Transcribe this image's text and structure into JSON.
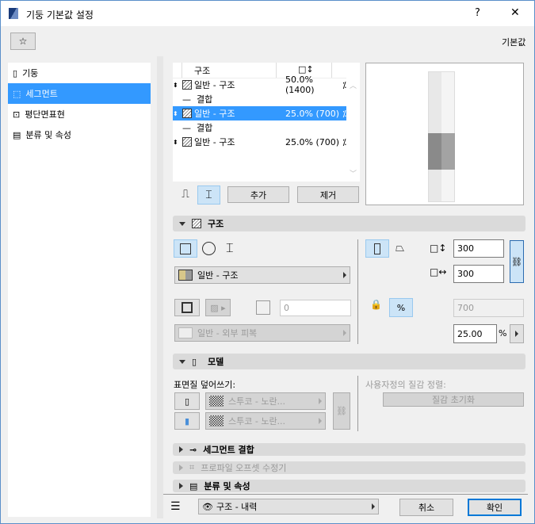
{
  "window": {
    "title": "기둥 기본값 설정",
    "help": "?",
    "close": "✕",
    "defaults_label": "기본값"
  },
  "sidebar": {
    "items": [
      {
        "label": "기둥",
        "icon": "column-icon"
      },
      {
        "label": "세그먼트",
        "icon": "segment-icon"
      },
      {
        "label": "평단면표현",
        "icon": "floor-plan-icon"
      },
      {
        "label": "분류 및 속성",
        "icon": "document-icon"
      }
    ],
    "selected": 1
  },
  "segments_table": {
    "headers": [
      "구조",
      "□↕"
    ],
    "rows": [
      {
        "type": "segment",
        "name": "일반 - 구조",
        "size": "50.0% (1400)"
      },
      {
        "type": "joint",
        "name": "결합"
      },
      {
        "type": "segment",
        "name": "일반 - 구조",
        "size": "25.0% (700)",
        "selected": true
      },
      {
        "type": "joint",
        "name": "결합"
      },
      {
        "type": "segment",
        "name": "일반 - 구조",
        "size": "25.0% (700)"
      }
    ]
  },
  "buttons": {
    "add": "추가",
    "remove": "제거",
    "cancel": "취소",
    "ok": "확인"
  },
  "structure": {
    "title": "구조",
    "material": "일반 - 구조",
    "offset": "0",
    "veneer": "일반 - 외부 피복",
    "width": "300",
    "depth": "300",
    "length": "700",
    "percent": "25.00",
    "percent_unit": "%"
  },
  "model": {
    "title": "모델",
    "override_label": "표면질 덮어쓰기:",
    "surface1": "스투코 - 노란...",
    "surface2": "스투코 - 노란...",
    "custom_align_label": "사용자정의 질감 정렬:",
    "reset_texture": "질감 초기화"
  },
  "sections": {
    "segment_joint": "세그먼트 결합",
    "profile_offset": "프로파일 오프셋 수정기",
    "classification": "분류 및 속성"
  },
  "footer": {
    "layer": "구조 - 내력"
  },
  "colors": {
    "accent": "#3399ff",
    "selected_toggle": "#cce4f7"
  }
}
